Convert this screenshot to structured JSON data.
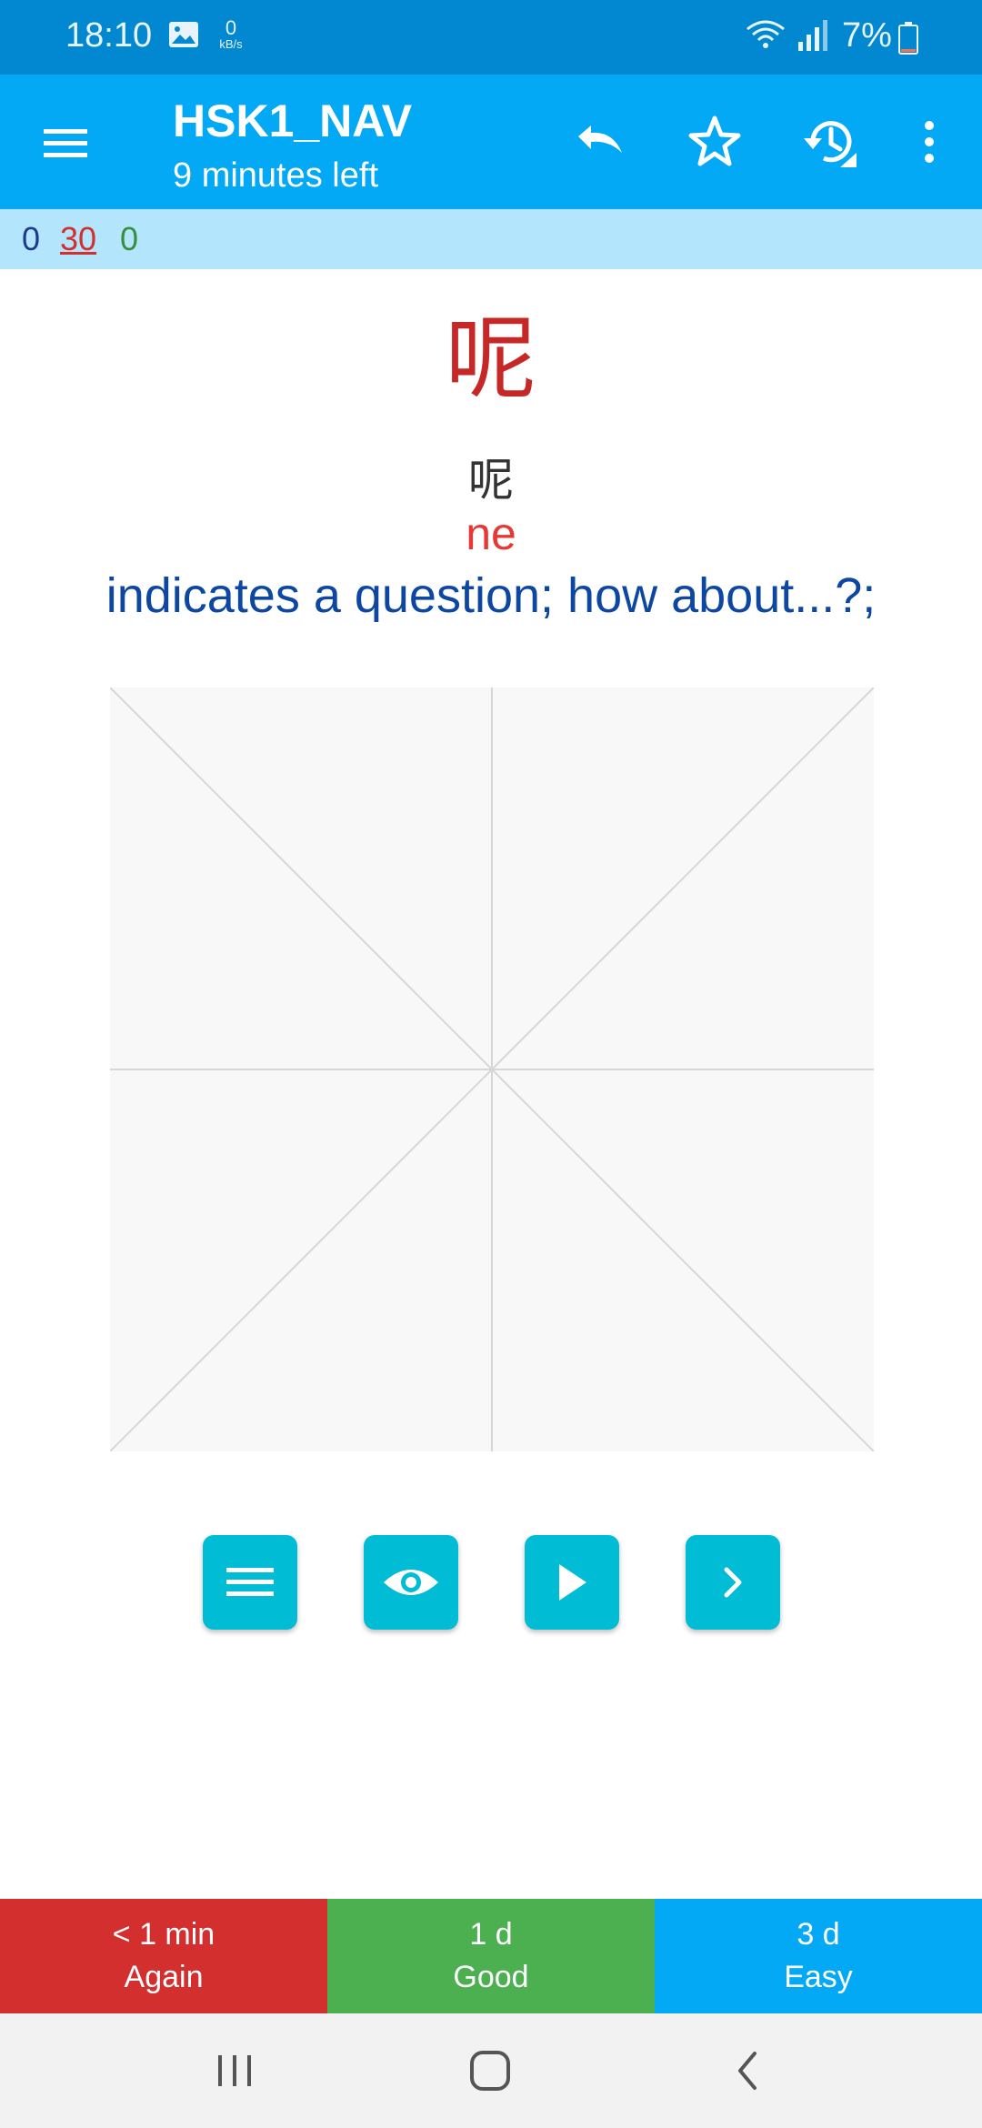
{
  "status_bar": {
    "time": "18:10",
    "net_speed": "0",
    "net_unit": "kB/s",
    "battery": "7%"
  },
  "app_bar": {
    "title": "HSK1_NAV",
    "subtitle": "9 minutes left",
    "icons": [
      "menu-icon",
      "undo-icon",
      "star-icon",
      "history-icon",
      "more-vert-icon"
    ]
  },
  "counts": {
    "new": "0",
    "learning": "30",
    "review": "0"
  },
  "card": {
    "hanzi_large": "呢",
    "hanzi_small": "呢",
    "pinyin": "ne",
    "meaning": "indicates a question; how about...?;"
  },
  "controls": [
    "menu-icon",
    "eye-icon",
    "play-icon",
    "chevron-right-icon"
  ],
  "answers": {
    "again": {
      "interval": "< 1 min",
      "label": "Again"
    },
    "good": {
      "interval": "1 d",
      "label": "Good"
    },
    "easy": {
      "interval": "3 d",
      "label": "Easy"
    }
  },
  "colors": {
    "status_bar": "#0288d1",
    "app_bar": "#03a9f4",
    "counts_bar": "#b3e5fc",
    "hanzi": "#c62828",
    "pinyin": "#e53935",
    "meaning": "#0d47a1",
    "control_button": "#00bcd4",
    "again": "#d32f2f",
    "good": "#4caf50",
    "easy": "#03a9f4"
  }
}
